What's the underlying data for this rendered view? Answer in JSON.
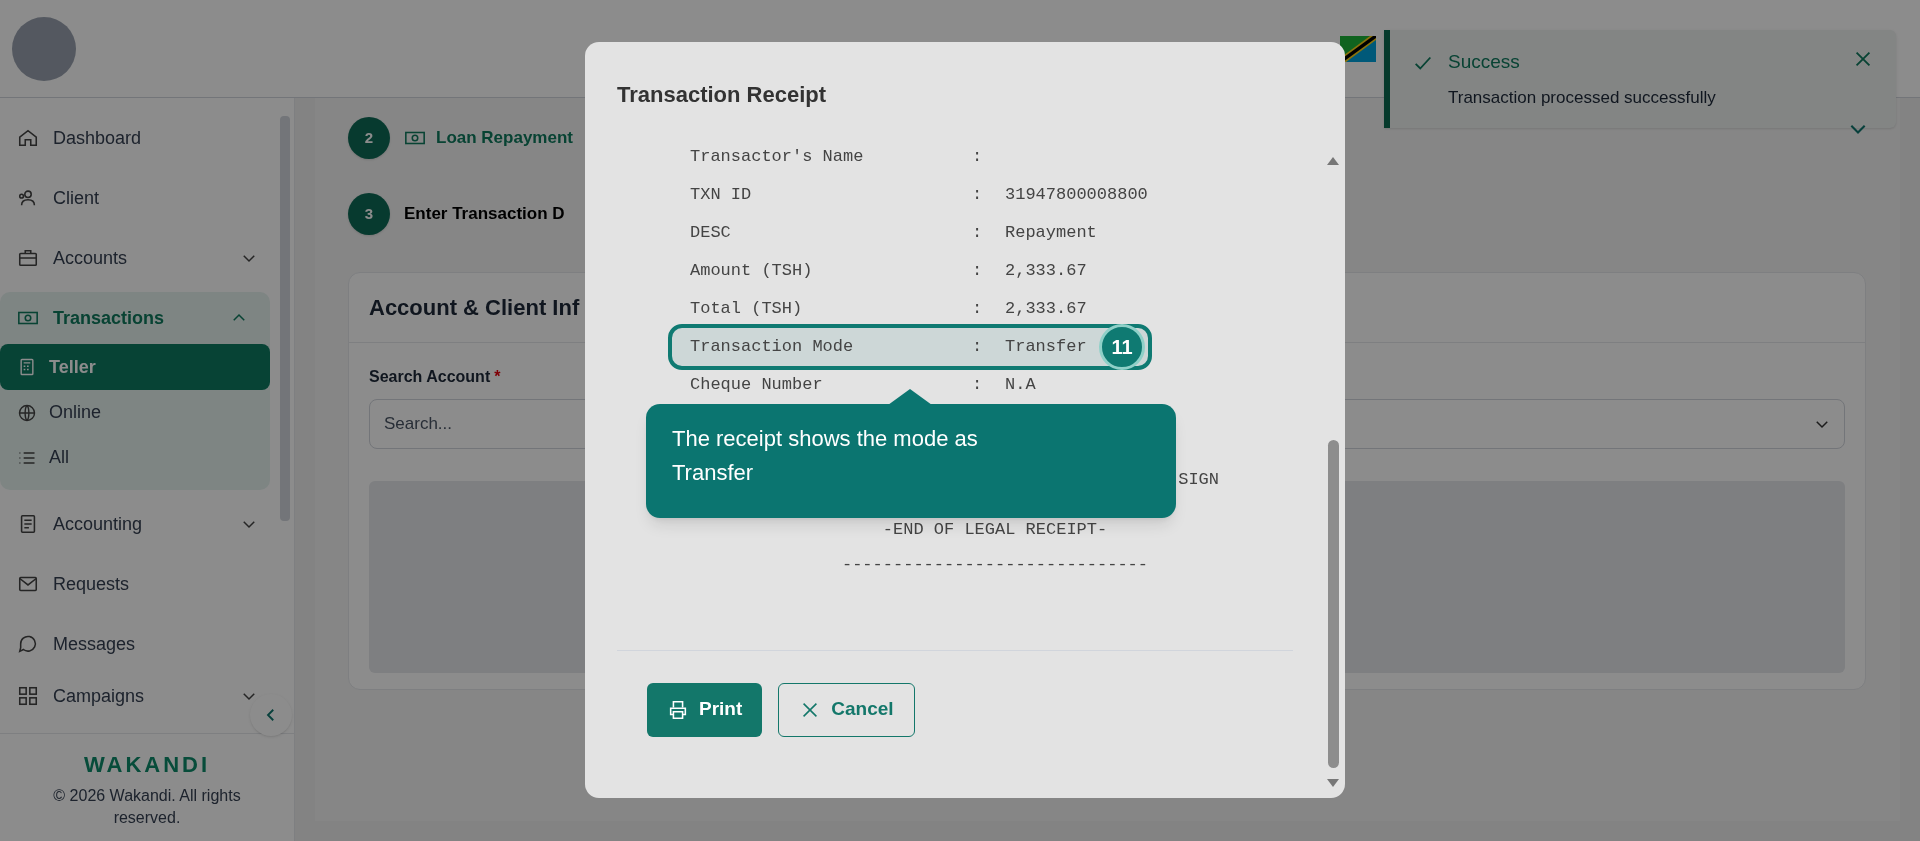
{
  "sidebar": {
    "items": [
      {
        "label": "Dashboard"
      },
      {
        "label": "Client"
      },
      {
        "label": "Accounts",
        "expanded": false
      },
      {
        "label": "Transactions",
        "expanded": true,
        "selected": true,
        "children": [
          {
            "label": "Teller",
            "selected": true
          },
          {
            "label": "Online",
            "selected": false
          },
          {
            "label": "All",
            "selected": false
          }
        ]
      },
      {
        "label": "Accounting",
        "expanded": false
      },
      {
        "label": "Requests"
      },
      {
        "label": "Messages"
      },
      {
        "label": "Campaigns",
        "expanded": false
      }
    ],
    "footer": {
      "brand": "WAKANDI",
      "copyright": "© 2026 Wakandi. All rights reserved."
    }
  },
  "steps": [
    {
      "number": "2",
      "label": "Loan Repayment",
      "kind": "done"
    },
    {
      "number": "3",
      "label": "Enter Transaction D",
      "kind": "current"
    }
  ],
  "card": {
    "title": "Account & Client Inf",
    "search_label": "Search Account",
    "required_mark": "*",
    "placeholder": "Search..."
  },
  "toast": {
    "title": "Success",
    "message": "Transaction processed successfully"
  },
  "modal": {
    "title": "Transaction Receipt",
    "rows": [
      {
        "label": "Transactor's Name",
        "separator": ":",
        "value": "",
        "highlighted": false
      },
      {
        "label": "TXN ID",
        "separator": ":",
        "value": "31947800008800",
        "highlighted": false
      },
      {
        "label": "DESC",
        "separator": ":",
        "value": "Repayment",
        "highlighted": false
      },
      {
        "label": "Amount (TSH)",
        "separator": ":",
        "value": "2,333.67",
        "highlighted": false
      },
      {
        "label": "Total (TSH)",
        "separator": ":",
        "value": "2,333.67",
        "highlighted": false
      },
      {
        "label": "Transaction Mode",
        "separator": ":",
        "value": "Transfer",
        "highlighted": true
      },
      {
        "label": "Cheque Number",
        "separator": ":",
        "value": "N.A",
        "highlighted": false
      }
    ],
    "partial_line": "SIGN",
    "end_line": "-END OF LEGAL RECEIPT-",
    "rule_line": "------------------------------",
    "buttons": [
      {
        "label": "Print",
        "kind": "primary"
      },
      {
        "label": "Cancel",
        "kind": "secondary"
      }
    ]
  },
  "tour": {
    "step": "11",
    "text": "The receipt shows the mode as Transfer"
  }
}
